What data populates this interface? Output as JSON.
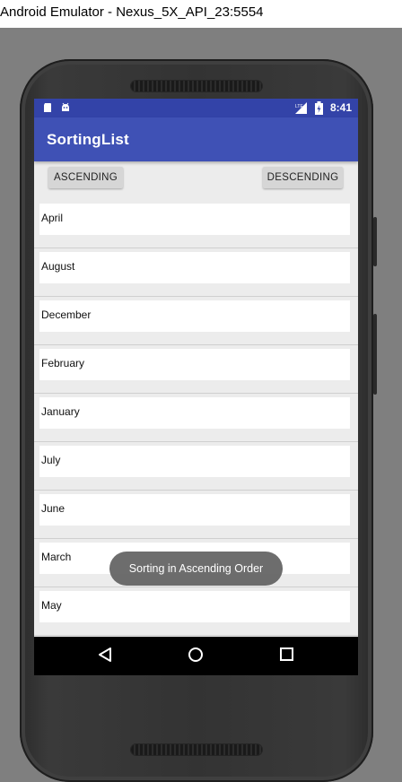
{
  "window": {
    "title": "Android Emulator - Nexus_5X_API_23:5554"
  },
  "status_bar": {
    "time": "8:41",
    "left_icons": [
      "sd-card-icon",
      "android-debug-icon"
    ],
    "right_icons": [
      "signal-lte-icon",
      "battery-charging-icon"
    ]
  },
  "app_bar": {
    "title": "SortingList",
    "color": "#3f51b5",
    "status_color": "#3343a8"
  },
  "buttons": {
    "ascending": "ASCENDING",
    "descending": "DESCENDING"
  },
  "list": {
    "items": [
      "April",
      "August",
      "December",
      "February",
      "January",
      "July",
      "June",
      "March",
      "May"
    ]
  },
  "toast": {
    "text": "Sorting in Ascending Order"
  },
  "nav_bar": {
    "icons": [
      "back-icon",
      "home-icon",
      "recents-icon"
    ]
  }
}
